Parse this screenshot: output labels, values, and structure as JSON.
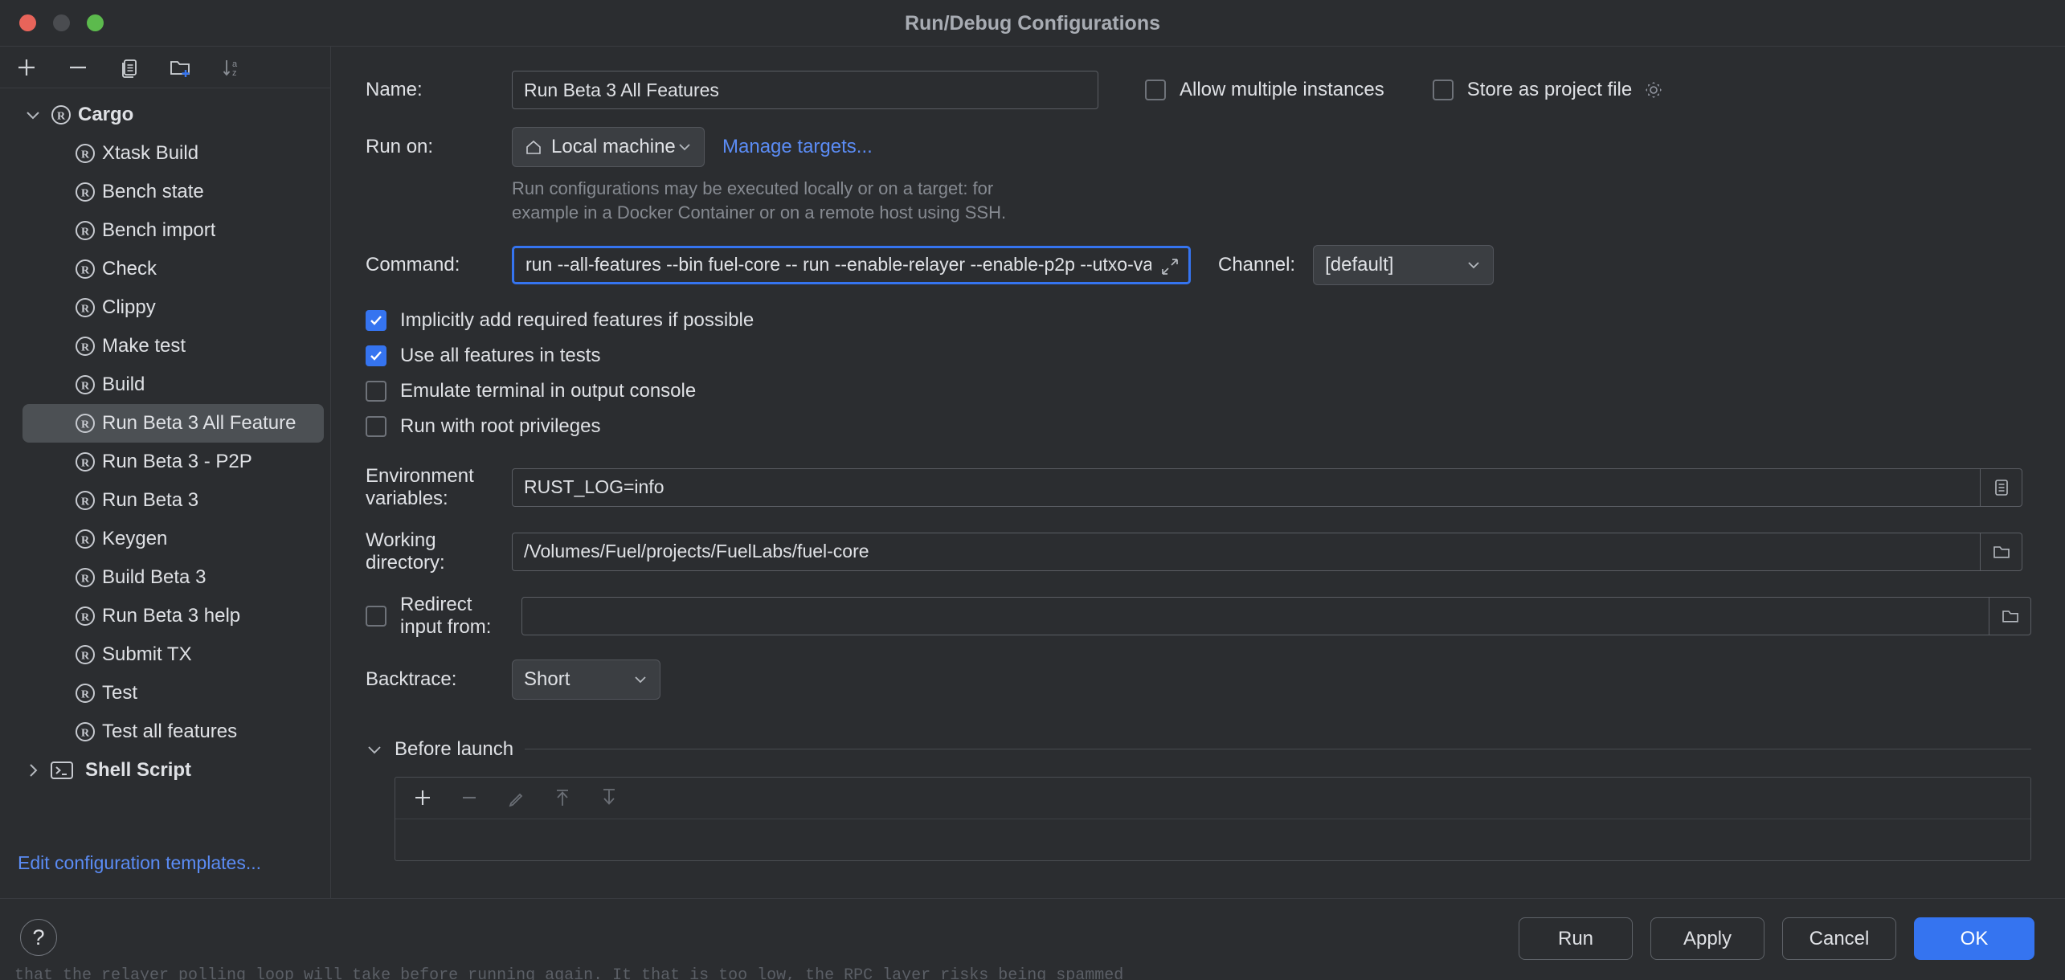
{
  "window": {
    "title": "Run/Debug Configurations",
    "traffic_lights": [
      "close-red",
      "minimize-grey",
      "zoom-green"
    ]
  },
  "left_panel": {
    "toolbar": [
      {
        "name": "add-configuration-button",
        "icon": "plus-icon"
      },
      {
        "name": "remove-configuration-button",
        "icon": "minus-icon"
      },
      {
        "name": "copy-configuration-button",
        "icon": "copy-icon"
      },
      {
        "name": "new-folder-button",
        "icon": "folder-plus-icon"
      },
      {
        "name": "sort-configurations-button",
        "icon": "sort-az-icon"
      }
    ],
    "tree": [
      {
        "label": "Cargo",
        "type": "group",
        "expanded": true,
        "icon": "rust-icon"
      },
      {
        "label": "Xtask Build",
        "type": "child",
        "icon": "rust-icon"
      },
      {
        "label": "Bench state",
        "type": "child",
        "icon": "rust-icon"
      },
      {
        "label": "Bench import",
        "type": "child",
        "icon": "rust-icon"
      },
      {
        "label": "Check",
        "type": "child",
        "icon": "rust-icon"
      },
      {
        "label": "Clippy",
        "type": "child",
        "icon": "rust-icon"
      },
      {
        "label": "Make test",
        "type": "child",
        "icon": "rust-icon"
      },
      {
        "label": "Build",
        "type": "child",
        "icon": "rust-icon"
      },
      {
        "label": "Run Beta 3 All Feature",
        "type": "child",
        "icon": "rust-icon",
        "selected": true
      },
      {
        "label": "Run Beta 3 - P2P",
        "type": "child",
        "icon": "rust-icon"
      },
      {
        "label": "Run Beta 3",
        "type": "child",
        "icon": "rust-icon"
      },
      {
        "label": "Keygen",
        "type": "child",
        "icon": "rust-icon"
      },
      {
        "label": "Build Beta 3",
        "type": "child",
        "icon": "rust-icon"
      },
      {
        "label": "Run Beta 3 help",
        "type": "child",
        "icon": "rust-icon"
      },
      {
        "label": "Submit TX",
        "type": "child",
        "icon": "rust-icon"
      },
      {
        "label": "Test",
        "type": "child",
        "icon": "rust-icon"
      },
      {
        "label": "Test all features",
        "type": "child",
        "icon": "rust-icon"
      },
      {
        "label": "Shell Script",
        "type": "group",
        "expanded": false,
        "icon": "shell-icon"
      }
    ],
    "edit_templates_link": "Edit configuration templates..."
  },
  "form": {
    "name_label": "Name:",
    "name_value": "Run Beta 3 All Features",
    "allow_multiple_instances": {
      "label": "Allow multiple instances",
      "checked": false
    },
    "store_as_project_file": {
      "label": "Store as project file",
      "checked": false,
      "gear_icon": "gear-icon"
    },
    "run_on_label": "Run on:",
    "run_on_value": "Local machine",
    "run_on_icon": "home-icon",
    "manage_targets_link": "Manage targets...",
    "run_on_hint_line1": "Run configurations may be executed locally or on a target: for",
    "run_on_hint_line2": "example in a Docker Container or on a remote host using SSH.",
    "command_label": "Command:",
    "command_value": "run --all-features --bin fuel-core -- run --enable-relayer --enable-p2p --utxo-validation --poa-instant false",
    "command_expand_icon": "expand-icon",
    "channel_label": "Channel:",
    "channel_value": "[default]",
    "checkboxes": [
      {
        "label": "Implicitly add required features if possible",
        "checked": true,
        "name": "implicitly-add-features-checkbox"
      },
      {
        "label": "Use all features in tests",
        "checked": true,
        "name": "use-all-features-tests-checkbox"
      },
      {
        "label": "Emulate terminal in output console",
        "checked": false,
        "name": "emulate-terminal-checkbox"
      },
      {
        "label": "Run with root privileges",
        "checked": false,
        "name": "run-root-privileges-checkbox"
      }
    ],
    "env_label": "Environment variables:",
    "env_value": "RUST_LOG=info",
    "env_button_icon": "list-icon",
    "workdir_label": "Working directory:",
    "workdir_value": "/Volumes/Fuel/projects/FuelLabs/fuel-core",
    "workdir_button_icon": "folder-icon",
    "redirect_label": "Redirect input from:",
    "redirect_checked": false,
    "redirect_value": "",
    "redirect_button_icon": "folder-icon",
    "backtrace_label": "Backtrace:",
    "backtrace_value": "Short",
    "before_launch_title": "Before launch",
    "before_launch_toolbar": [
      {
        "name": "add-task-button",
        "icon": "plus-icon",
        "enabled": true
      },
      {
        "name": "remove-task-button",
        "icon": "minus-icon",
        "enabled": false
      },
      {
        "name": "edit-task-button",
        "icon": "pencil-icon",
        "enabled": false
      },
      {
        "name": "move-up-task-button",
        "icon": "arrow-up-icon",
        "enabled": false
      },
      {
        "name": "move-down-task-button",
        "icon": "arrow-down-icon",
        "enabled": false
      }
    ]
  },
  "footer": {
    "help_label": "?",
    "run_label": "Run",
    "apply_label": "Apply",
    "cancel_label": "Cancel",
    "ok_label": "OK"
  },
  "background": {
    "text": "that the relayer polling loop will take before running again.  It that is too low, the RPC layer risks being spammed"
  },
  "colors": {
    "accent": "#3574f0",
    "link": "#5b8cf5",
    "panel": "#2b2d30",
    "selection": "#4c5054"
  }
}
